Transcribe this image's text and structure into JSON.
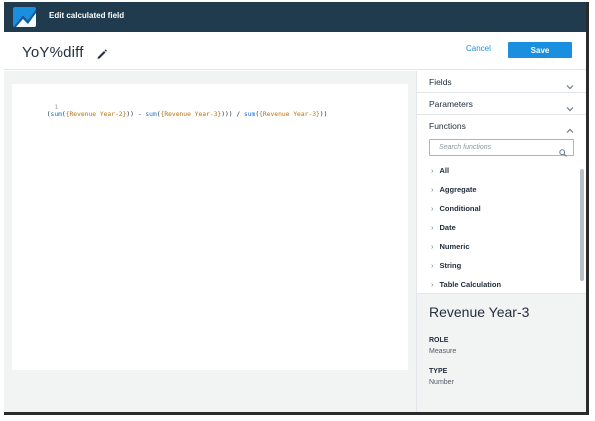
{
  "titlebar": {
    "title": "Edit calculated field"
  },
  "header": {
    "field_name": "YoY%diff",
    "cancel_label": "Cancel",
    "save_label": "Save"
  },
  "editor": {
    "line_number": "1",
    "tokens": [
      {
        "text": "(",
        "kind": "op"
      },
      {
        "text": "sum",
        "kind": "fn"
      },
      {
        "text": "(",
        "kind": "op"
      },
      {
        "text": "{Revenue Year-2}",
        "kind": "str"
      },
      {
        "text": ")) - ",
        "kind": "op"
      },
      {
        "text": "sum",
        "kind": "fn"
      },
      {
        "text": "(",
        "kind": "op"
      },
      {
        "text": "{Revenue Year-3}",
        "kind": "str"
      },
      {
        "text": "))) / ",
        "kind": "op"
      },
      {
        "text": "sum",
        "kind": "fn"
      },
      {
        "text": "(",
        "kind": "op"
      },
      {
        "text": "{Revenue Year-3}",
        "kind": "str"
      },
      {
        "text": "))",
        "kind": "op"
      }
    ]
  },
  "sidebar": {
    "fields_label": "Fields",
    "parameters_label": "Parameters",
    "functions_label": "Functions",
    "search_placeholder": "Search functions",
    "function_categories": [
      "All",
      "Aggregate",
      "Conditional",
      "Date",
      "Numeric",
      "String",
      "Table Calculation"
    ],
    "details": {
      "title": "Revenue Year-3",
      "role_label": "ROLE",
      "role_value": "Measure",
      "type_label": "TYPE",
      "type_value": "Number"
    }
  },
  "icons": {
    "logo": "quicksight-logo-icon",
    "edit": "pencil-icon",
    "collapse": "chevron-down-icon",
    "expand": "chevron-up-icon",
    "search": "search-icon",
    "category": "chevron-right-icon"
  },
  "colors": {
    "titlebar": "#1f3b4d",
    "accent": "#1a8fe0",
    "function_token": "#1a6fd0",
    "field_token": "#b7730f",
    "panel_bg": "#f2f3f3"
  }
}
